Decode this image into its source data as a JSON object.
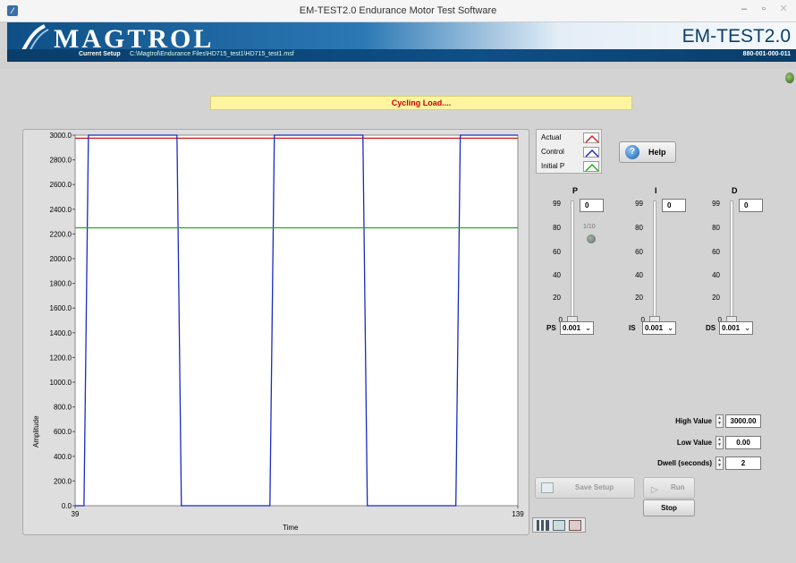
{
  "window": {
    "title": "EM-TEST2.0 Endurance Motor Test Software"
  },
  "banner": {
    "logo_text": "MAGTROL",
    "product": "EM-TEST2.0",
    "setup_label": "Current Setup",
    "setup_path": "C:\\Magtrol\\Endurance Files\\HD715_test1\\HD715_test1.msf",
    "part_number": "880-001-000-011"
  },
  "status": {
    "message": "Cycling Load...."
  },
  "chart_data": {
    "type": "line",
    "xlabel": "Time",
    "ylabel": "Amplitude",
    "xlim": [
      39,
      139
    ],
    "ylim": [
      0,
      3000
    ],
    "x_tick_labels": [
      "39",
      "139"
    ],
    "y_tick_labels": [
      "3000.0",
      "2800.0",
      "2600.0",
      "2400.0",
      "2200.0",
      "2000.0",
      "1800.0",
      "1600.0",
      "1400.0",
      "1200.0",
      "1000.0",
      "800.0",
      "600.0",
      "400.0",
      "200.0",
      "0.0"
    ],
    "series": [
      {
        "name": "Actual",
        "color": "#cc2222",
        "x": [
          39,
          139
        ],
        "values": [
          2975,
          2975
        ]
      },
      {
        "name": "Control",
        "color": "#1a2bbf",
        "x": [
          39,
          41,
          42,
          62,
          63,
          83,
          84,
          104,
          105,
          125,
          126,
          139
        ],
        "values": [
          0,
          0,
          3000,
          3000,
          0,
          0,
          3000,
          3000,
          0,
          0,
          3000,
          3000
        ]
      },
      {
        "name": "Initial P",
        "color": "#22aa22",
        "x": [
          39,
          139
        ],
        "values": [
          2250,
          2250
        ]
      }
    ]
  },
  "legend": {
    "items": [
      {
        "label": "Actual",
        "color": "#cc2222"
      },
      {
        "label": "Control",
        "color": "#1a2bbf"
      },
      {
        "label": "Initial P",
        "color": "#22aa22"
      }
    ]
  },
  "help": {
    "label": "Help"
  },
  "pid": {
    "scale": [
      "99",
      "80",
      "60",
      "40",
      "20",
      "0"
    ],
    "led_label": "1/10",
    "controls": [
      {
        "name": "P",
        "value": "0",
        "scale_label": "PS",
        "scale_value": "0.001"
      },
      {
        "name": "I",
        "value": "0",
        "scale_label": "IS",
        "scale_value": "0.001"
      },
      {
        "name": "D",
        "value": "0",
        "scale_label": "DS",
        "scale_value": "0.001"
      }
    ]
  },
  "fields": {
    "high_label": "High Value",
    "high_value": "3000.00",
    "low_label": "Low Value",
    "low_value": "0.00",
    "dwell_label": "Dwell (seconds)",
    "dwell_value": "2"
  },
  "buttons": {
    "save_setup": "Save Setup",
    "run": "Run",
    "stop": "Stop"
  }
}
